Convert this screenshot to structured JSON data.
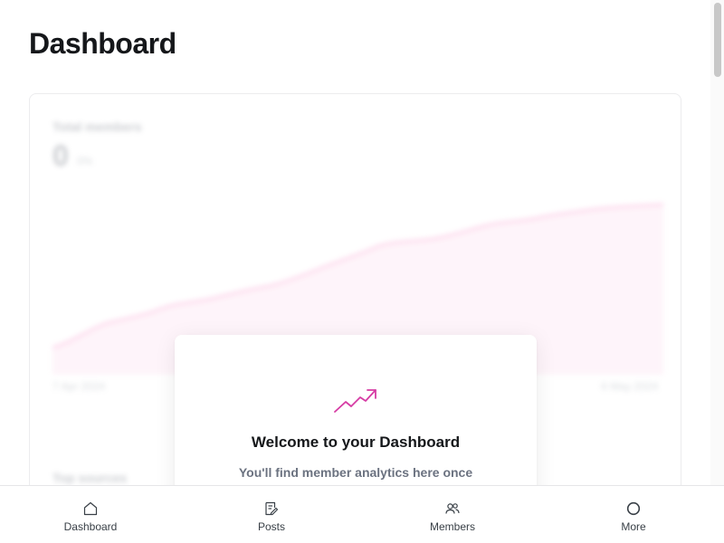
{
  "page": {
    "title": "Dashboard"
  },
  "chart_card": {
    "label": "Total members",
    "value": "0",
    "delta": "0%",
    "date_start": "7 Apr 2024",
    "date_end": "6 May 2024",
    "sources_label": "Top sources",
    "accent": "#f9a8d4"
  },
  "welcome": {
    "icon": "trending-up-icon",
    "title": "Welcome to your Dashboard",
    "text": "You'll find member analytics here once",
    "accent": "#d63ca4"
  },
  "bottom_nav": {
    "items": [
      {
        "label": "Dashboard",
        "icon": "home-icon"
      },
      {
        "label": "Posts",
        "icon": "posts-icon"
      },
      {
        "label": "Members",
        "icon": "members-icon"
      },
      {
        "label": "More",
        "icon": "more-icon"
      }
    ]
  }
}
